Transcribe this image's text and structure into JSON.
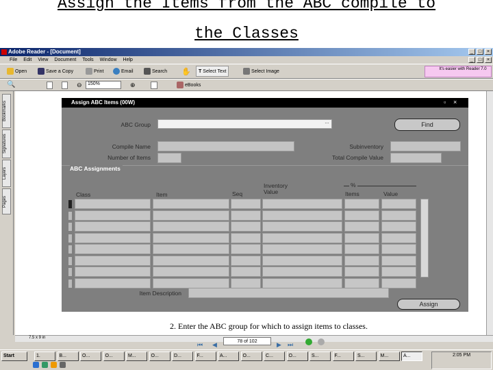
{
  "slide": {
    "title_line1": "Assign the Items from the ABC compile to",
    "title_line2": "the Classes",
    "instruction": "2.   Enter the ABC group for which to assign items to classes."
  },
  "app": {
    "title": "Adobe Reader - [Document]",
    "menu": [
      "File",
      "Edit",
      "View",
      "Document",
      "Tools",
      "Window",
      "Help"
    ],
    "toolbar1": [
      "Open",
      "Save a Copy",
      "Print",
      "Email",
      "Search",
      "Select Text",
      "Select Image"
    ],
    "promo": "It's easier with Reader 7.0",
    "zoom": "150%",
    "ebooks": "eBooks",
    "nav_tabs": [
      "Bookmarks",
      "Signatures",
      "Layers",
      "Pages"
    ],
    "page_size": "7.5 x 9 in",
    "page_indicator": "78 of 102"
  },
  "form": {
    "title": "Assign ABC Items (00W)",
    "abc_group_label": "ABC Group",
    "abc_group_value": "",
    "find_label": "Find",
    "compile_name_label": "Compile Name",
    "number_of_items_label": "Number of Items",
    "subinventory_label": "Subinventory",
    "total_compile_value_label": "Total Compile Value",
    "section_label": "ABC Assignments",
    "columns": {
      "class": "Class",
      "item": "Item",
      "seq": "Seq",
      "inventory_value": "Inventory Value",
      "percent_group": "%",
      "items": "Items",
      "value": "Value"
    },
    "row_count": 8,
    "item_description_label": "Item Description",
    "assign_label": "Assign"
  },
  "taskbar": {
    "start": "Start",
    "buttons": [
      "1.",
      "B...",
      "O...",
      "O...",
      "M...",
      "O...",
      "D...",
      "F...",
      "A...",
      "O...",
      "C...",
      "O...",
      "S...",
      "F...",
      "S...",
      "M...",
      "A..."
    ],
    "clock": "2:05 PM"
  }
}
